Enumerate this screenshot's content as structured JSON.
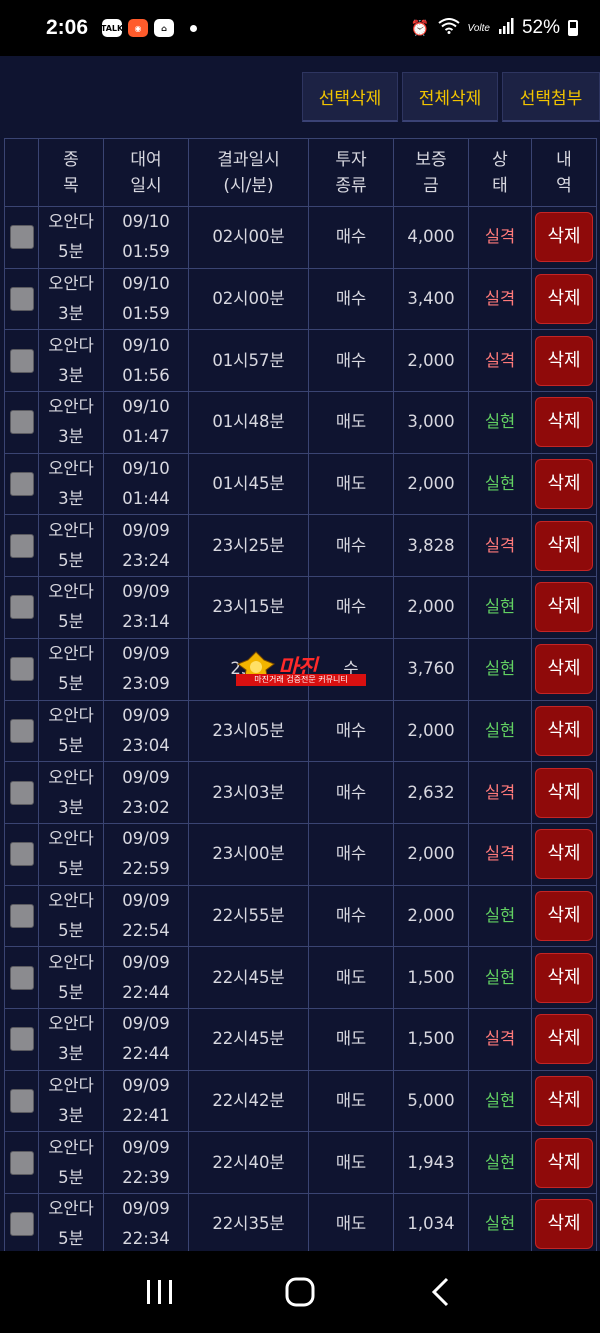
{
  "status_bar": {
    "time": "2:06",
    "notifications": [
      "TALK",
      "app-icon",
      "shop-icon"
    ],
    "battery": "52%",
    "network": "Volte"
  },
  "toolbar": {
    "delete_selected": "선택삭제",
    "delete_all": "전체삭제",
    "attach_selected": "선택첨부"
  },
  "table": {
    "headers": {
      "item": "종\n목",
      "rent_time": "대여\n일시",
      "result_time": "결과일시\n(시/분)",
      "invest_type": "투자\n종류",
      "deposit": "보증\n금",
      "status": "상\n태",
      "detail": "내\n역"
    },
    "delete_label": "삭제",
    "rows": [
      {
        "item": "오안다\n5분",
        "rent": "09/10\n01:59",
        "result": "02시00분",
        "type": "매수",
        "deposit": "4,000",
        "status": "실격",
        "win": false
      },
      {
        "item": "오안다\n3분",
        "rent": "09/10\n01:59",
        "result": "02시00분",
        "type": "매수",
        "deposit": "3,400",
        "status": "실격",
        "win": false
      },
      {
        "item": "오안다\n3분",
        "rent": "09/10\n01:56",
        "result": "01시57분",
        "type": "매수",
        "deposit": "2,000",
        "status": "실격",
        "win": false
      },
      {
        "item": "오안다\n3분",
        "rent": "09/10\n01:47",
        "result": "01시48분",
        "type": "매도",
        "deposit": "3,000",
        "status": "실현",
        "win": true
      },
      {
        "item": "오안다\n3분",
        "rent": "09/10\n01:44",
        "result": "01시45분",
        "type": "매도",
        "deposit": "2,000",
        "status": "실현",
        "win": true
      },
      {
        "item": "오안다\n5분",
        "rent": "09/09\n23:24",
        "result": "23시25분",
        "type": "매수",
        "deposit": "3,828",
        "status": "실격",
        "win": false
      },
      {
        "item": "오안다\n5분",
        "rent": "09/09\n23:14",
        "result": "23시15분",
        "type": "매수",
        "deposit": "2,000",
        "status": "실현",
        "win": true
      },
      {
        "item": "오안다\n5분",
        "rent": "09/09\n23:09",
        "result": "23시",
        "type": "수",
        "deposit": "3,760",
        "status": "실현",
        "win": true
      },
      {
        "item": "오안다\n5분",
        "rent": "09/09\n23:04",
        "result": "23시05분",
        "type": "매수",
        "deposit": "2,000",
        "status": "실현",
        "win": true
      },
      {
        "item": "오안다\n3분",
        "rent": "09/09\n23:02",
        "result": "23시03분",
        "type": "매수",
        "deposit": "2,632",
        "status": "실격",
        "win": false
      },
      {
        "item": "오안다\n5분",
        "rent": "09/09\n22:59",
        "result": "23시00분",
        "type": "매수",
        "deposit": "2,000",
        "status": "실격",
        "win": false
      },
      {
        "item": "오안다\n5분",
        "rent": "09/09\n22:54",
        "result": "22시55분",
        "type": "매수",
        "deposit": "2,000",
        "status": "실현",
        "win": true
      },
      {
        "item": "오안다\n5분",
        "rent": "09/09\n22:44",
        "result": "22시45분",
        "type": "매도",
        "deposit": "1,500",
        "status": "실현",
        "win": true
      },
      {
        "item": "오안다\n3분",
        "rent": "09/09\n22:44",
        "result": "22시45분",
        "type": "매도",
        "deposit": "1,500",
        "status": "실격",
        "win": false
      },
      {
        "item": "오안다\n3분",
        "rent": "09/09\n22:41",
        "result": "22시42분",
        "type": "매도",
        "deposit": "5,000",
        "status": "실현",
        "win": true
      },
      {
        "item": "오안다\n5분",
        "rent": "09/09\n22:39",
        "result": "22시40분",
        "type": "매도",
        "deposit": "1,943",
        "status": "실현",
        "win": true
      },
      {
        "item": "오안다\n5분",
        "rent": "09/09\n22:34",
        "result": "22시35분",
        "type": "매도",
        "deposit": "1,034",
        "status": "실현",
        "win": true
      }
    ]
  },
  "watermark": {
    "title": "마진",
    "subtitle": "마진거래 검증전문 커뮤니티"
  },
  "colors": {
    "background": "#0f1430",
    "toolbar_text": "#f2c400",
    "fail": "#ff7a7a",
    "win": "#62d062",
    "delete_button": "#8f0a0a"
  }
}
